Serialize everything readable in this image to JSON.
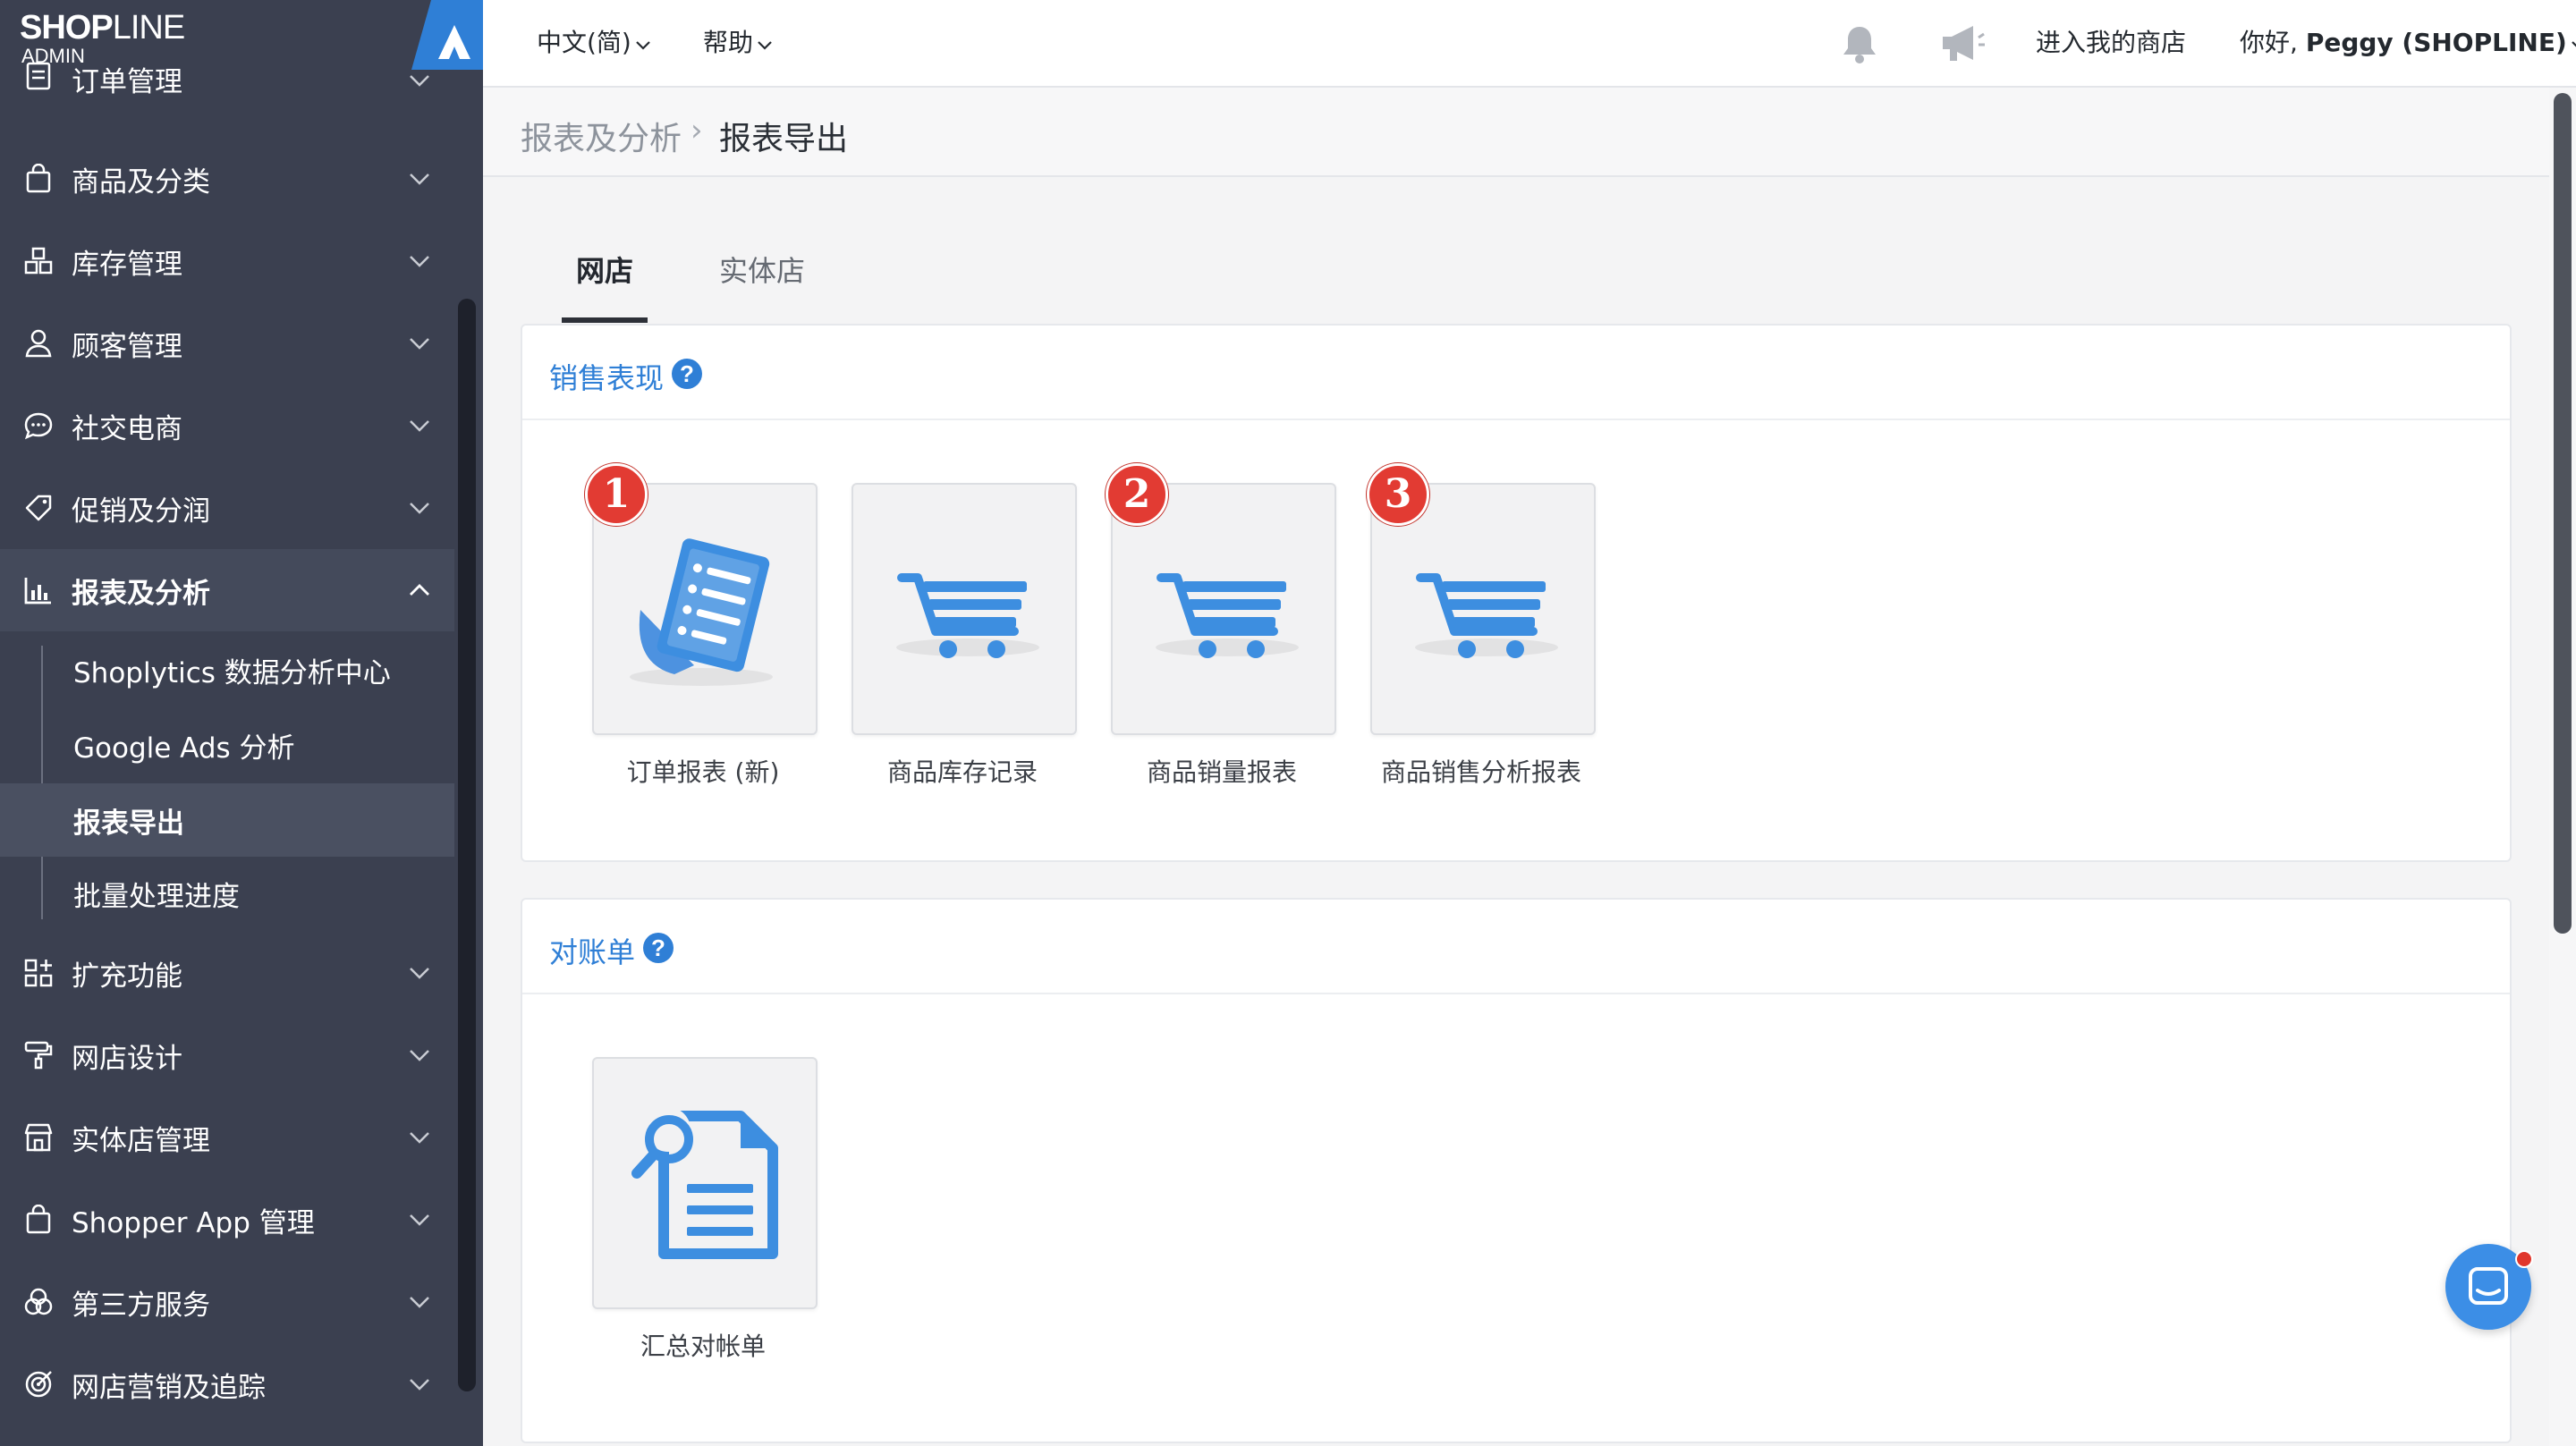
{
  "brand": {
    "name_bold": "SHOP",
    "name_thin": "LINE",
    "sub": "ADMIN"
  },
  "sidebar": {
    "items": [
      {
        "label": "订单管理",
        "icon": "order-icon"
      },
      {
        "label": "商品及分类",
        "icon": "shopping-bag-icon"
      },
      {
        "label": "库存管理",
        "icon": "inventory-icon"
      },
      {
        "label": "顾客管理",
        "icon": "customer-icon"
      },
      {
        "label": "社交电商",
        "icon": "chat-bubble-icon"
      },
      {
        "label": "促销及分润",
        "icon": "tag-icon"
      },
      {
        "label": "报表及分析",
        "icon": "chart-icon"
      },
      {
        "label": "扩充功能",
        "icon": "apps-icon"
      },
      {
        "label": "网店设计",
        "icon": "paint-roller-icon"
      },
      {
        "label": "实体店管理",
        "icon": "store-icon"
      },
      {
        "label": "Shopper App 管理",
        "icon": "shopping-bag-icon"
      },
      {
        "label": "第三方服务",
        "icon": "integrations-icon"
      },
      {
        "label": "网店营销及追踪",
        "icon": "target-icon"
      }
    ],
    "sub_items": [
      {
        "label": "Shoplytics 数据分析中心"
      },
      {
        "label": "Google Ads 分析"
      },
      {
        "label": "报表导出"
      },
      {
        "label": "批量处理进度"
      }
    ]
  },
  "topbar": {
    "language": "中文(简)",
    "help": "帮助",
    "enter_store": "进入我的商店",
    "greeting_prefix": "你好, ",
    "user_name": "Peggy (SHOPLINE)"
  },
  "breadcrumb": {
    "parent": "报表及分析",
    "separator": "›",
    "current": "报表导出"
  },
  "tabs": [
    {
      "label": "网店"
    },
    {
      "label": "实体店"
    }
  ],
  "sections": {
    "sales": {
      "title": "销售表现",
      "cards": [
        {
          "label": "订单报表 (新)",
          "icon": "order-report-icon",
          "badge": "1"
        },
        {
          "label": "商品库存记录",
          "icon": "shopping-cart-icon",
          "badge": ""
        },
        {
          "label": "商品销量报表",
          "icon": "shopping-cart-icon",
          "badge": "2"
        },
        {
          "label": "商品销售分析报表",
          "icon": "shopping-cart-icon",
          "badge": "3"
        }
      ]
    },
    "reconciliation": {
      "title": "对账单",
      "cards": [
        {
          "label": "汇总对帐单",
          "icon": "document-search-icon"
        }
      ]
    }
  },
  "colors": {
    "sidebar_bg": "#3b4050",
    "accent_blue": "#2f7fd6",
    "icon_blue": "#3d8ee0",
    "badge_red": "#e23b33"
  }
}
